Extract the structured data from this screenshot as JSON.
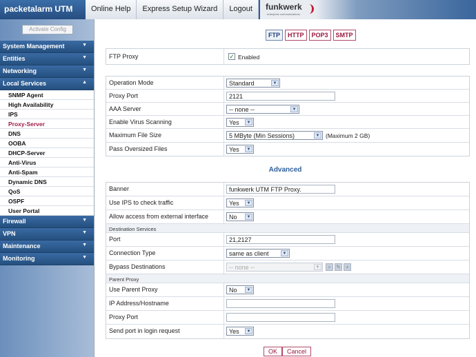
{
  "header": {
    "brand": "packetalarm UTM",
    "nav": [
      "Online Help",
      "Express Setup Wizard",
      "Logout"
    ],
    "logo_text": "funkwerk",
    "logo_sub": "enterprise communications"
  },
  "sidebar": {
    "activate_label": "Activate Config",
    "groups": {
      "system": "System Management",
      "entities": "Entities",
      "networking": "Networking",
      "local": "Local Services",
      "firewall": "Firewall",
      "vpn": "VPN",
      "maintenance": "Maintenance",
      "monitoring": "Monitoring"
    },
    "local_items": [
      "SNMP Agent",
      "High Availability",
      "IPS",
      "Proxy-Server",
      "DNS",
      "OOBA",
      "DHCP-Server",
      "Anti-Virus",
      "Anti-Spam",
      "Dynamic DNS",
      "QoS",
      "OSPF",
      "User Portal"
    ]
  },
  "subtabs": [
    "FTP",
    "HTTP",
    "POP3",
    "SMTP"
  ],
  "form": {
    "ftp_proxy": {
      "label": "FTP Proxy",
      "value": "Enabled"
    },
    "operation_mode": {
      "label": "Operation Mode",
      "value": "Standard"
    },
    "proxy_port": {
      "label": "Proxy Port",
      "value": "2121"
    },
    "aaa_server": {
      "label": "AAA Server",
      "value": "-- none --"
    },
    "virus_scanning": {
      "label": "Enable Virus Scanning",
      "value": "Yes"
    },
    "max_file_size": {
      "label": "Maximum File Size",
      "value": "5 MByte (Min Sessions)",
      "note": "(Maximum 2 GB)"
    },
    "pass_oversized": {
      "label": "Pass Oversized Files",
      "value": "Yes"
    }
  },
  "advanced": {
    "title": "Advanced",
    "banner": {
      "label": "Banner",
      "value": "funkwerk UTM FTP Proxy."
    },
    "use_ips": {
      "label": "Use IPS to check traffic",
      "value": "Yes"
    },
    "allow_external": {
      "label": "Allow access from external interface",
      "value": "No"
    },
    "dest_header": "Destination Services",
    "port": {
      "label": "Port",
      "value": "21,2127"
    },
    "connection_type": {
      "label": "Connection Type",
      "value": "same as client"
    },
    "bypass": {
      "label": "Bypass Destinations",
      "value": "-- none --"
    },
    "parent_header": "Parent Proxy",
    "use_parent": {
      "label": "Use Parent Proxy",
      "value": "No"
    },
    "ip_host": {
      "label": "IP Address/Hostname",
      "value": ""
    },
    "parent_port": {
      "label": "Proxy Port",
      "value": ""
    },
    "send_port": {
      "label": "Send port in login request",
      "value": "Yes"
    }
  },
  "buttons": {
    "ok": "OK",
    "cancel": "Cancel"
  }
}
